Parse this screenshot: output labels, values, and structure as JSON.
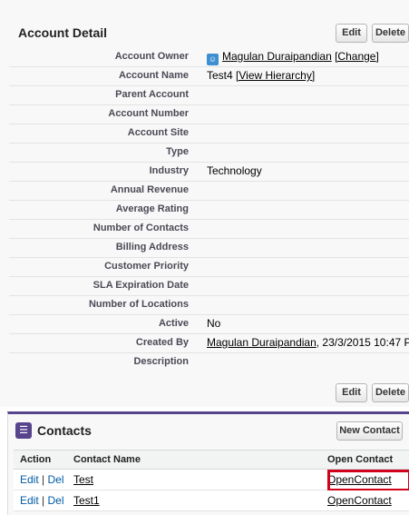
{
  "detail": {
    "title": "Account Detail",
    "edit_label": "Edit",
    "delete_label": "Delete",
    "fields": {
      "account_owner": {
        "label": "Account Owner",
        "value": "Magulan Duraipandian",
        "action": "[Change]"
      },
      "account_name": {
        "label": "Account Name",
        "value": "Test4",
        "action": "[View Hierarchy]"
      },
      "parent_account": {
        "label": "Parent Account",
        "value": ""
      },
      "account_number": {
        "label": "Account Number",
        "value": ""
      },
      "account_site": {
        "label": "Account Site",
        "value": ""
      },
      "type": {
        "label": "Type",
        "value": ""
      },
      "industry": {
        "label": "Industry",
        "value": "Technology"
      },
      "annual_revenue": {
        "label": "Annual Revenue",
        "value": ""
      },
      "average_rating": {
        "label": "Average Rating",
        "value": ""
      },
      "number_of_contacts": {
        "label": "Number of Contacts",
        "value": ""
      },
      "billing_address": {
        "label": "Billing Address",
        "value": ""
      },
      "customer_priority": {
        "label": "Customer Priority",
        "value": ""
      },
      "sla_expiration_date": {
        "label": "SLA Expiration Date",
        "value": ""
      },
      "number_of_locations": {
        "label": "Number of Locations",
        "value": ""
      },
      "active": {
        "label": "Active",
        "value": "No"
      },
      "created_by": {
        "label": "Created By",
        "value": "Magulan Duraipandian",
        "extra": ", 23/3/2015 10:47 P"
      },
      "description": {
        "label": "Description",
        "value": ""
      }
    }
  },
  "contacts": {
    "title": "Contacts",
    "new_button": "New Contact",
    "columns": {
      "action": "Action",
      "name": "Contact Name",
      "open": "Open Contact"
    },
    "rows": [
      {
        "edit": "Edit",
        "sep": "|",
        "del": "Del",
        "name": "Test",
        "open": "OpenContact"
      },
      {
        "edit": "Edit",
        "sep": "|",
        "del": "Del",
        "name": "Test1",
        "open": "OpenContact"
      }
    ]
  },
  "colors": {
    "accent": "#56458c",
    "highlight": "#d0021b",
    "link": "#015ba7"
  },
  "icons": {
    "owner": "user-avatar-icon",
    "contacts": "contacts-icon"
  }
}
